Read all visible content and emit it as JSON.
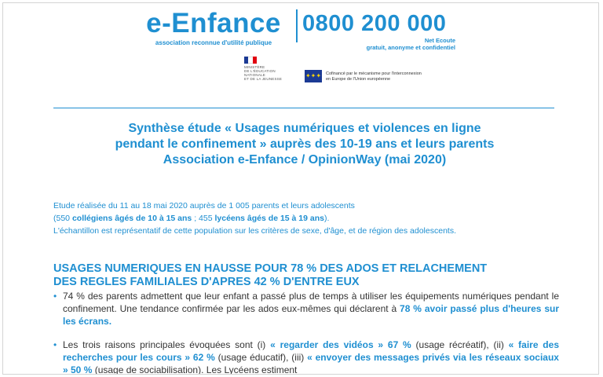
{
  "header": {
    "brand": "e-Enfance",
    "tagline": "association reconnue d'utilité publique",
    "phone": "0800 200 000",
    "phone_sub_1": "Net Ecoute",
    "phone_sub_2": "gratuit, anonyme et confidentiel"
  },
  "logos": {
    "ministry_lines": [
      "MINISTÈRE",
      "DE L'ÉDUCATION",
      "NATIONALE",
      "ET DE LA JEUNESSE"
    ],
    "eu_line_1": "Cofinancé par le mécanisme pour l'interconnexion",
    "eu_line_2": "en Europe de l'Union européenne"
  },
  "title": {
    "line1": "Synthèse étude « Usages numériques et violences en ligne",
    "line2": "pendant le confinement » auprès des 10-19 ans et leurs parents",
    "line3": "Association e-Enfance / OpinionWay (mai 2020)"
  },
  "intro": {
    "line1": "Etude réalisée du 11 au 18 mai 2020 auprès de 1 005 parents et leurs adolescents",
    "l2_a": "(550 ",
    "l2_b": "collégiens âgés de 10 à 15 ans",
    "l2_c": " ; 455 ",
    "l2_d": "lycéens âgés de 15 à 19 ans",
    "l2_e": ").",
    "line3": "L'échantillon est représentatif de cette population sur les critères de sexe, d'âge, et de région des adolescents."
  },
  "section": {
    "heading_1": "USAGES NUMERIQUES EN HAUSSE POUR 78 % DES ADOS ET RELACHEMENT",
    "heading_2": "DES REGLES FAMILIALES D'APRES 42 % D'ENTRE EUX",
    "bullet": "•",
    "b1_a": "74 % des parents admettent que leur enfant a passé plus de temps à utiliser les équipements numériques pendant le confinement. Une tendance confirmée par les ados eux-mêmes qui déclarent à ",
    "b1_b": "78 % avoir passé plus d'heures sur les écrans.",
    "b2_a": "Les trois raisons principales évoquées sont (i) ",
    "b2_b": "« regarder des vidéos » 67 %",
    "b2_c": " (usage récréatif), (ii) ",
    "b2_d": "« faire des recherches pour les cours » 62 %",
    "b2_e": " (usage éducatif), (iii) ",
    "b2_f": "« envoyer des messages privés via les réseaux sociaux » 50 %",
    "b2_g": " (usage de sociabilisation). Les Lycéens estiment"
  },
  "colors": {
    "accent": "#1f8fd1",
    "text": "#333333",
    "eu_blue": "#1b3a94",
    "eu_star": "#f5d20a"
  }
}
